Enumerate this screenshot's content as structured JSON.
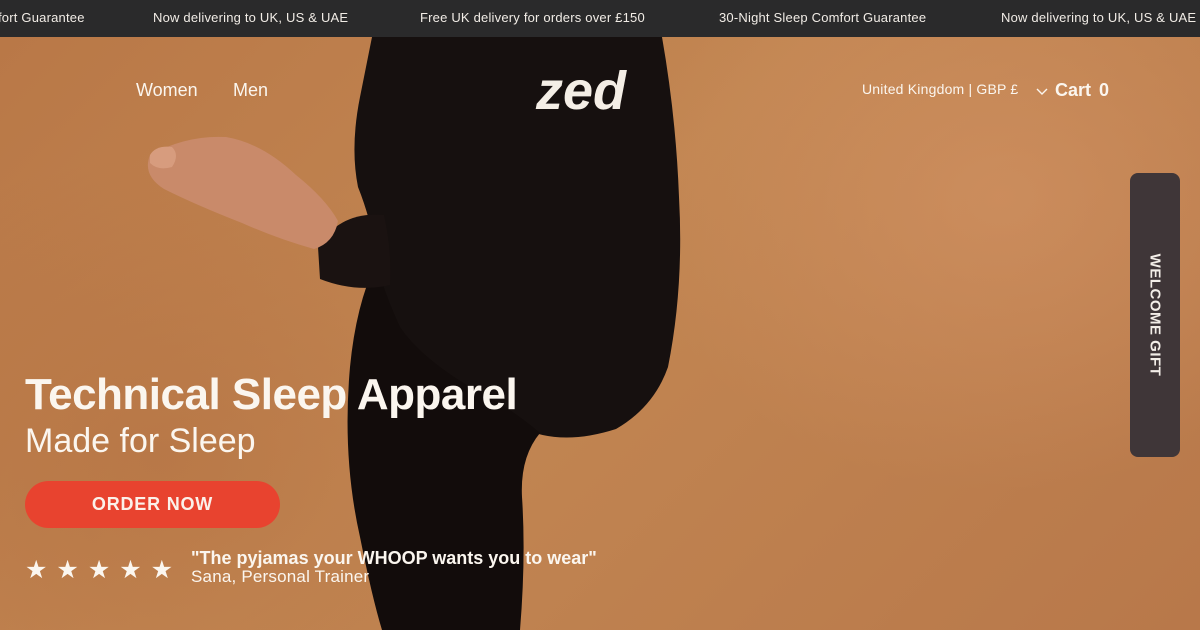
{
  "announcement_bar": {
    "messages": [
      "fort Guarantee",
      "Now delivering to UK, US & UAE",
      "Free UK delivery for orders over £150",
      "30-Night Sleep Comfort Guarantee",
      "Now delivering to UK, US & UAE"
    ]
  },
  "header": {
    "nav": {
      "women": "Women",
      "men": "Men"
    },
    "logo_text": "zed",
    "region_selector": "United Kingdom | GBP £",
    "cart": {
      "label": "Cart",
      "count": "0"
    }
  },
  "side_tab": {
    "label": "WELCOME GIFT"
  },
  "hero": {
    "title": "Technical Sleep Apparel",
    "subtitle": "Made for Sleep",
    "cta_label": "ORDER NOW",
    "rating_stars": "★★★★★",
    "rating_value": 5,
    "testimonial_quote": "\"The pyjamas your WHOOP wants you to wear\"",
    "testimonial_author": "Sana, Personal Trainer"
  },
  "colors": {
    "announcement_bg": "#2a2a2b",
    "hero_bg": "#b97a4c",
    "cta": "#e8432f",
    "side_tab": "#3f3638",
    "text_light": "#fbf6ef"
  },
  "icons": [
    "chevron-down-icon",
    "star-icon",
    "zed-logo"
  ]
}
